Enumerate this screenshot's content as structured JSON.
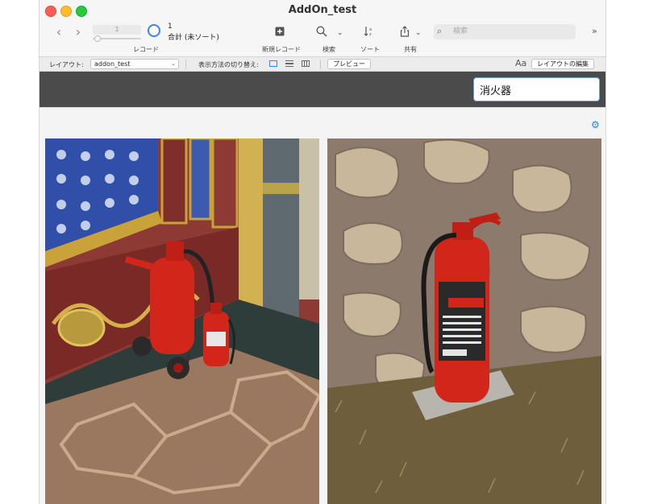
{
  "window": {
    "title": "AddOn_test"
  },
  "toolbar": {
    "record_current": "1",
    "record_field_value": "1",
    "record_total": "合計 (未ソート)",
    "records_label": "レコード",
    "new_record_label": "新規レコード",
    "find_label": "検索",
    "sort_label": "ソート",
    "share_label": "共有",
    "search_placeholder": "検索",
    "new_record_icon": "plus-square-icon",
    "find_icon": "magnifier-icon",
    "sort_icon": "sort-az-icon",
    "share_icon": "share-icon"
  },
  "layoutbar": {
    "layout_label": "レイアウト:",
    "layout_value": "addon_test",
    "view_switch_label": "表示方法の切り替え:",
    "preview_button": "プレビュー",
    "edit_layout_button": "レイアウトの編集",
    "text_size_icon": "Aa"
  },
  "header": {
    "search_value": "消火器"
  },
  "colors": {
    "header_band": "#4b4b4b",
    "accent": "#3b82f6",
    "extinguisher_red": "#d3261a"
  },
  "photos": [
    {
      "subject": "fire extinguishers in ornate tiled corner"
    },
    {
      "subject": "fire extinguisher against stone wall"
    }
  ]
}
